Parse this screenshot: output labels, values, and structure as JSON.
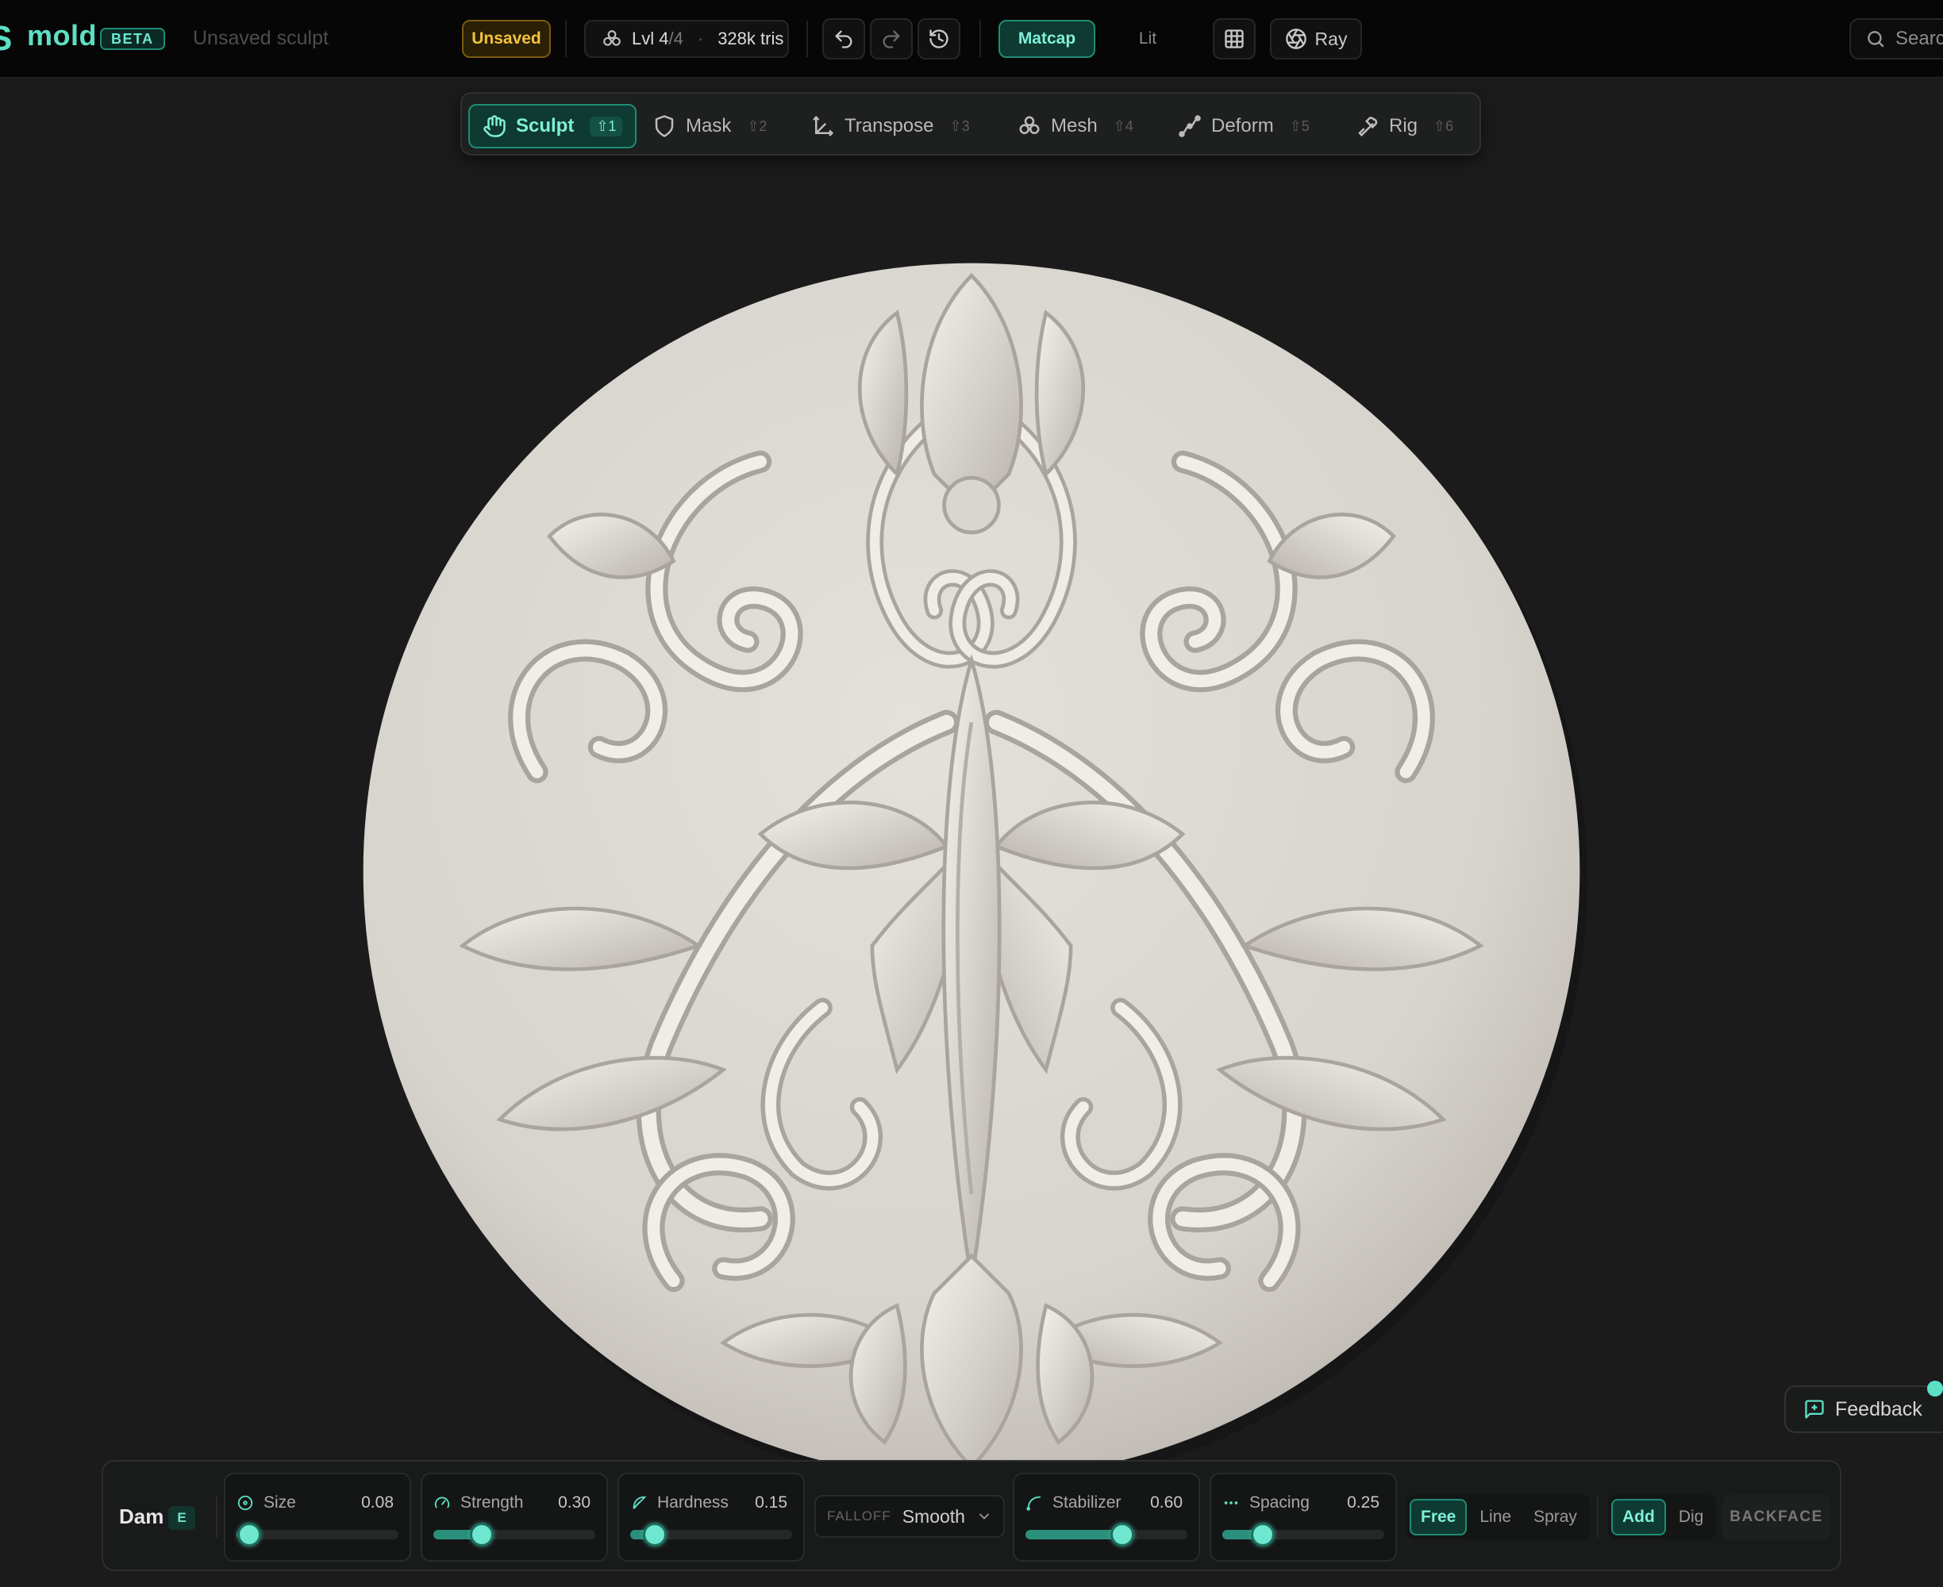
{
  "header": {
    "logo_glyph": "S",
    "brand": "mold",
    "beta_badge": "BETA",
    "document_title": "Unsaved sculpt",
    "save_status": "Unsaved",
    "level_label": "Lvl",
    "level_current": "4",
    "level_total": "/4",
    "triangle_count": "328k tris",
    "shading_modes": [
      "Matcap",
      "Lit"
    ],
    "active_shading": "Matcap",
    "render_button": "Ray",
    "search_placeholder": "Search"
  },
  "modes": [
    {
      "label": "Sculpt",
      "shortcut": "⇧1",
      "icon": "hand-icon",
      "active": true
    },
    {
      "label": "Mask",
      "shortcut": "⇧2",
      "icon": "shield-icon",
      "active": false
    },
    {
      "label": "Transpose",
      "shortcut": "⇧3",
      "icon": "axis-icon",
      "active": false
    },
    {
      "label": "Mesh",
      "shortcut": "⇧4",
      "icon": "mesh-icon",
      "active": false
    },
    {
      "label": "Deform",
      "shortcut": "⇧5",
      "icon": "deform-icon",
      "active": false
    },
    {
      "label": "Rig",
      "shortcut": "⇧6",
      "icon": "bone-icon",
      "active": false
    }
  ],
  "feedback_label": "Feedback",
  "brush": {
    "name": "Dam",
    "shortcut": "E",
    "sliders": [
      {
        "label": "Size",
        "value": "0.08",
        "level": 0.08,
        "icon": "circle-icon"
      },
      {
        "label": "Strength",
        "value": "0.30",
        "level": 0.3,
        "icon": "gauge-icon"
      },
      {
        "label": "Hardness",
        "value": "0.15",
        "level": 0.15,
        "icon": "feather-icon"
      },
      {
        "label": "Stabilizer",
        "value": "0.60",
        "level": 0.6,
        "icon": "curve-icon"
      },
      {
        "label": "Spacing",
        "value": "0.25",
        "level": 0.25,
        "icon": "dots-icon"
      }
    ],
    "falloff_label": "FALLOFF",
    "falloff_value": "Smooth",
    "stroke_modes": [
      "Free",
      "Line",
      "Spray"
    ],
    "active_stroke": "Free",
    "direction_modes": [
      "Add",
      "Dig"
    ],
    "active_direction": "Add",
    "backface_label": "BACKFACE"
  },
  "colors": {
    "accent": "#5ce0c4",
    "warning": "#f2c340",
    "background": "#1b1b1b",
    "clay": "#dcd8d2"
  }
}
